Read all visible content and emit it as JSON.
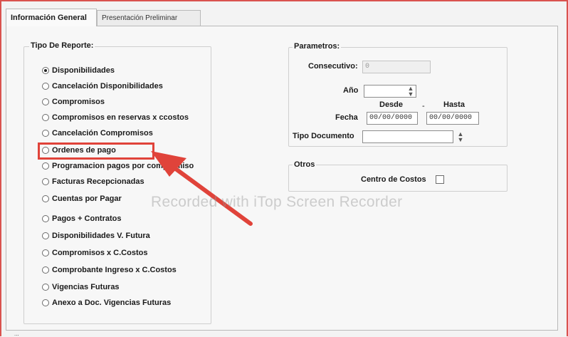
{
  "tabs": [
    "Información General",
    "Presentación Preliminar"
  ],
  "tipo_reporte": {
    "title": "Tipo De Reporte:",
    "options": [
      "Disponibilidades",
      "Cancelación Disponibilidades",
      "Compromisos",
      "Compromisos en reservas x ccostos",
      "Cancelación Compromisos",
      "Ordenes de pago",
      "Programacion pagos por compromiso",
      "Facturas Recepcionadas",
      "Cuentas por Pagar",
      "Pagos + Contratos",
      "Disponibilidades V. Futura",
      "Compromisos x C.Costos",
      "Comprobante Ingreso x C.Costos",
      "Vigencias Futuras",
      "Anexo a Doc. Vigencias Futuras"
    ],
    "selected": "Disponibilidades"
  },
  "parametros": {
    "title": "Parametros:",
    "consecutivo_label": "Consecutivo:",
    "consecutivo_value": "0",
    "anio_label": "Año",
    "anio_value": "",
    "desde_label": "Desde",
    "hasta_label": "Hasta",
    "dash": "-",
    "fecha_label": "Fecha",
    "fecha_desde": "00/00/0000",
    "fecha_hasta": "00/00/0000",
    "tipo_documento_label": "Tipo Documento",
    "tipo_documento_value": ""
  },
  "otros": {
    "title": "Otros",
    "centro_costos_label": "Centro de Costos",
    "centro_costos_checked": false
  },
  "watermark": "Recorded with iTop Screen Recorder",
  "bottom_text": "...",
  "colors": {
    "highlight": "#e0433a",
    "frame": "#d9534f",
    "panel": "#f7f7f7"
  },
  "icons": [
    "spinner-icon",
    "annotation-arrow-icon"
  ]
}
